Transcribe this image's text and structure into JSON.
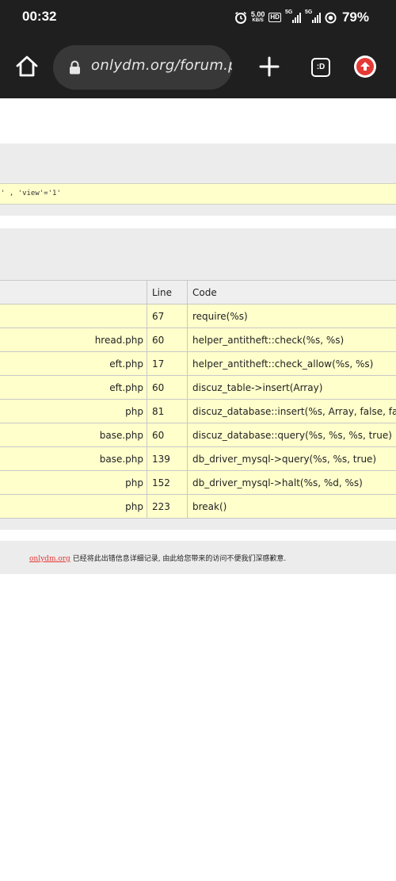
{
  "status_bar": {
    "time": "00:32",
    "net_speed_value": "5.00",
    "net_speed_unit": "KB/S",
    "hd_label": "HD",
    "sim1_tag": "5G",
    "sim2_tag": "5G",
    "battery": "79%"
  },
  "browser": {
    "url": "onlydm.org/forum.p",
    "tab_count_label": ":D",
    "icons": [
      "home-icon",
      "lock-icon",
      "plus-icon",
      "tab-switcher-icon",
      "menu-icon"
    ]
  },
  "error_page": {
    "sql_fragment": "' , 'view'='1'",
    "trace_table": {
      "headers": [
        "",
        "Line",
        "Code"
      ],
      "rows": [
        {
          "file": "",
          "line": "67",
          "code": "require(%s)"
        },
        {
          "file": "hread.php",
          "line": "60",
          "code": "helper_antitheft::check(%s, %s)"
        },
        {
          "file": "eft.php",
          "line": "17",
          "code": "helper_antitheft::check_allow(%s, %s)"
        },
        {
          "file": "eft.php",
          "line": "60",
          "code": "discuz_table->insert(Array)"
        },
        {
          "file": "php",
          "line": "81",
          "code": "discuz_database::insert(%s, Array, false, fa"
        },
        {
          "file": "base.php",
          "line": "60",
          "code": "discuz_database::query(%s, %s, %s, true)"
        },
        {
          "file": "base.php",
          "line": "139",
          "code": "db_driver_mysql->query(%s, %s, true)"
        },
        {
          "file": "php",
          "line": "152",
          "code": "db_driver_mysql->halt(%s, %d, %s)"
        },
        {
          "file": "php",
          "line": "223",
          "code": "break()"
        }
      ]
    },
    "footer": {
      "link_text": "onlydm.org",
      "message": "已经将此出错信息详细记录, 由此给您带来的访问不便我们深感歉意."
    }
  },
  "colors": {
    "chrome_bg": "#1f1f1f",
    "url_bar_bg": "#373837",
    "panel_bg": "#ececec",
    "cell_bg": "#ffffcc",
    "link": "#e53935"
  }
}
